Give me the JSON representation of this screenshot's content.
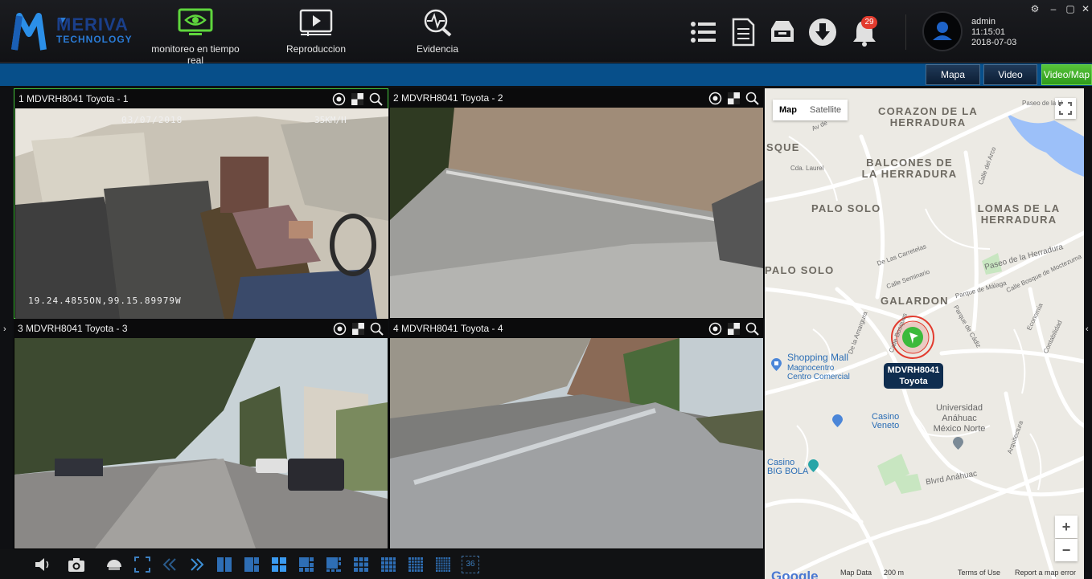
{
  "logo": {
    "line1": "MERIVA",
    "line2": "TECHNOLOGY"
  },
  "nav": [
    {
      "label": "monitoreo en tiempo real"
    },
    {
      "label": "Reproduccion"
    },
    {
      "label": "Evidencia"
    }
  ],
  "notifications": {
    "count": "29"
  },
  "user": {
    "name": "admin",
    "time": "11:15:01",
    "date": "2018-07-03"
  },
  "view_buttons": {
    "map": "Mapa",
    "video": "Video",
    "videomap": "Video/Map"
  },
  "cameras": [
    {
      "title": "1 MDVRH8041 Toyota - 1",
      "osd_date": "03/07/2018",
      "osd_speed": "35KM/H",
      "osd_coords": "19.24.4855ON,99.15.89979W"
    },
    {
      "title": "2 MDVRH8041 Toyota - 2"
    },
    {
      "title": "3 MDVRH8041 Toyota - 3"
    },
    {
      "title": "4 MDVRH8041 Toyota - 4"
    }
  ],
  "bottom_toolbar": {
    "layout_36": "36"
  },
  "map": {
    "tabs": {
      "map": "Map",
      "satellite": "Satellite"
    },
    "areas": [
      "CORAZON DE LA HERRADURA",
      "SQUE",
      "BALCONES DE LA HERRADURA",
      "PALO SOLO",
      "LOMAS DE LA HERRADURA",
      "PALO SOLO",
      "GALARDON"
    ],
    "streets": [
      "Paseo de la H",
      "Av de",
      "Cda. Laurel",
      "Calle del Arco",
      "De Las Carretelas",
      "Paseo de la Herradura",
      "Calle Seminario",
      "Calle Bosque de Moctezuma",
      "De la Amargura",
      "Parque de Málaga",
      "Calle Bosques",
      "Parque de Cádiz",
      "Economía",
      "Contabilidad",
      "Arquitectura",
      "Blvrd Anáhuac"
    ],
    "pois": {
      "shopping": "Shopping Mall",
      "magnocentro": "Magnocentro Centro Comercial",
      "casino_veneto": "Casino Veneto",
      "casino_big_bola": "Casino BIG BOLA",
      "university": "Universidad Anáhuac México Norte"
    },
    "vehicle": {
      "line1": "MDVRH8041",
      "line2": "Toyota"
    },
    "zoom_in": "+",
    "zoom_out": "−",
    "footer": {
      "google": "Google",
      "map_data": "Map Data",
      "scale": "200 m",
      "terms": "Terms of Use",
      "report": "Report a map error"
    }
  }
}
